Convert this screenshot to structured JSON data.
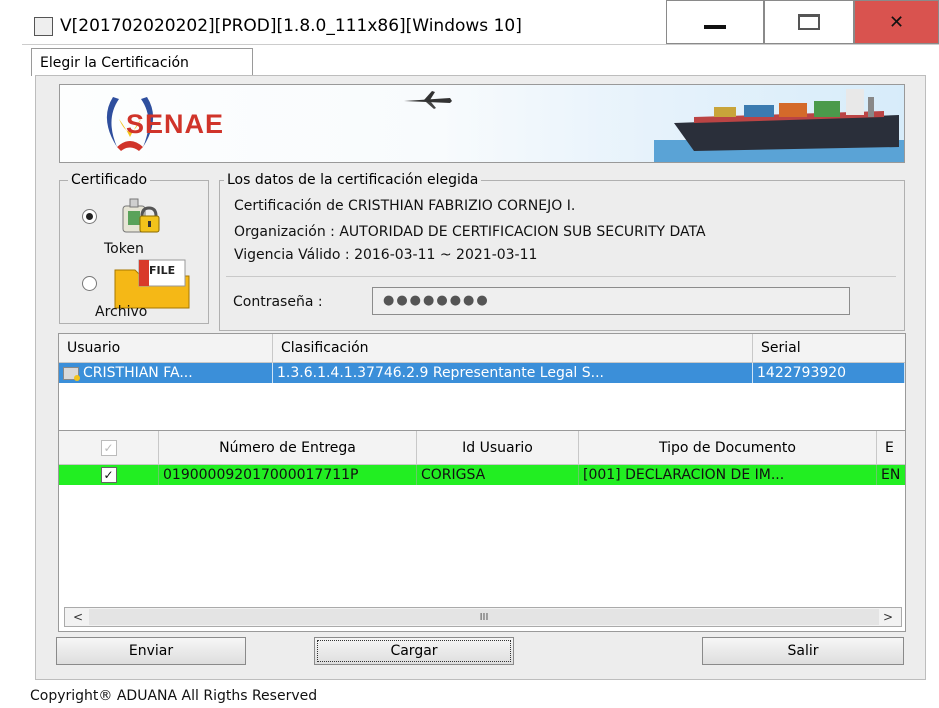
{
  "window": {
    "title": "V[201702020202][PROD][1.8.0_111x86][Windows 10]",
    "controls": [
      "minimize",
      "maximize",
      "close"
    ]
  },
  "tab": {
    "label": "Elegir la Certificación"
  },
  "banner": {
    "brand": "SENAE"
  },
  "certificado": {
    "legend": "Certificado",
    "token_label": "Token",
    "archivo_label": "Archivo",
    "file_badge": "FILE",
    "selected": "Token"
  },
  "datos": {
    "legend": "Los datos de la certificación elegida",
    "certificacion": "Certificación de CRISTHIAN FABRIZIO CORNEJO I.",
    "organizacion": "Organización : AUTORIDAD DE CERTIFICACION SUB SECURITY DATA",
    "vigencia": "Vigencia Válido : 2016-03-11 ~ 2021-03-11",
    "password_label": "Contraseña :",
    "password_value": "●●●●●●●●"
  },
  "cert_table": {
    "headers": [
      "Usuario",
      "Clasificación",
      "Serial"
    ],
    "rows": [
      [
        "CRISTHIAN FA...",
        "1.3.6.1.4.1.37746.2.9 Representante Legal S...",
        "1422793920"
      ]
    ]
  },
  "delivery_table": {
    "headers": [
      "",
      "Número de Entrega",
      "Id Usuario",
      "Tipo de Documento",
      "E"
    ],
    "rows": [
      {
        "checked": true,
        "numero": "019000092017000017711P",
        "usuario": "CORIGSA",
        "tipo": "[001] DECLARACION DE IM...",
        "e": "EN"
      }
    ]
  },
  "scrollbar": {
    "left": "<",
    "grip": "III",
    "right": ">"
  },
  "buttons": {
    "enviar": "Enviar",
    "cargar": "Cargar",
    "salir": "Salir"
  },
  "footer": {
    "copyright": "Copyright® ADUANA All Rigths Reserved"
  },
  "colors": {
    "selection": "#3b8fd9",
    "green_row": "#22ee22",
    "close": "#d9534f"
  }
}
